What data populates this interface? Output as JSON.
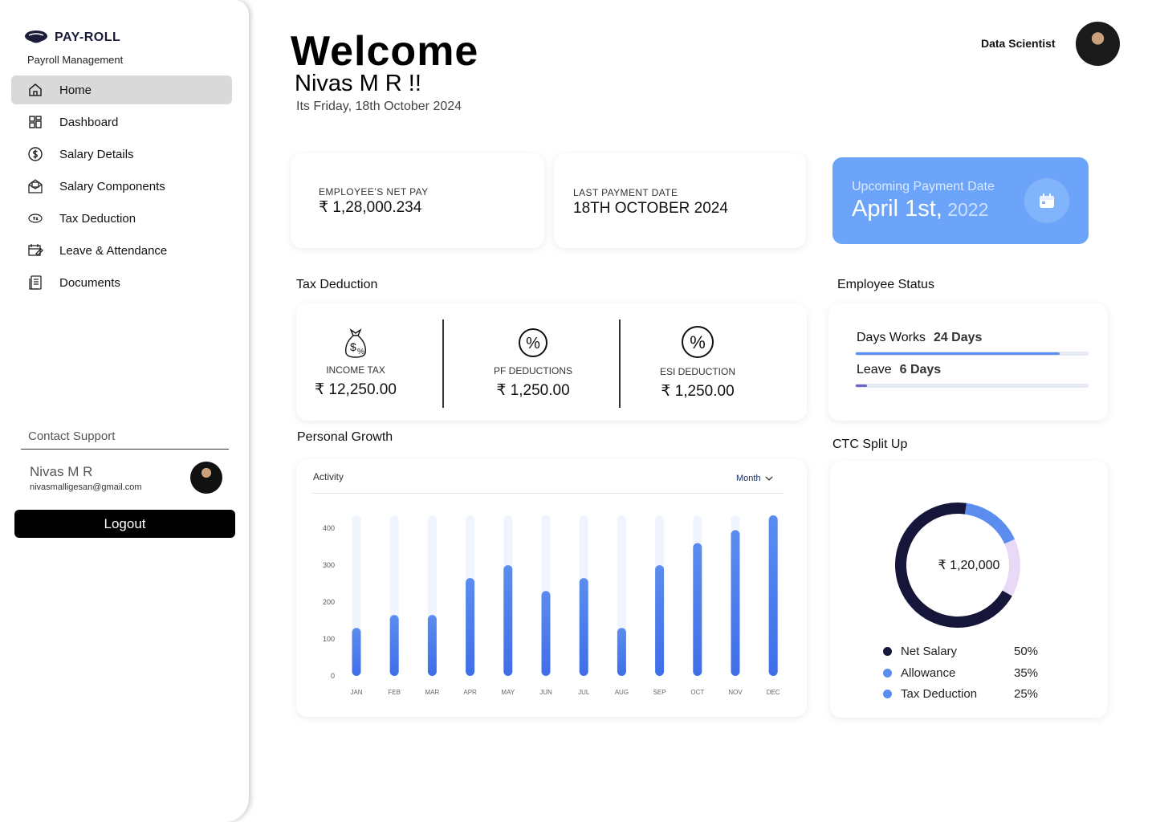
{
  "sidebar": {
    "brand": "PAY-ROLL",
    "subtitle": "Payroll Management",
    "items": [
      {
        "label": "Home",
        "icon": "home-icon"
      },
      {
        "label": "Dashboard",
        "icon": "dashboard-icon"
      },
      {
        "label": "Salary Details",
        "icon": "dollar-circle-icon"
      },
      {
        "label": "Salary Components",
        "icon": "envelope-icon"
      },
      {
        "label": "Tax Deduction",
        "icon": "tax-icon"
      },
      {
        "label": "Leave & Attendance",
        "icon": "calendar-edit-icon"
      },
      {
        "label": "Documents",
        "icon": "document-icon"
      }
    ],
    "support_title": "Contact Support",
    "user_name": "Nivas M R",
    "user_email": "nivasmalligesan@gmail.com",
    "logout": "Logout"
  },
  "header": {
    "welcome": "Welcome",
    "name": "Nivas M R !!",
    "date": "Its Friday, 18th October 2024",
    "role": "Data Scientist"
  },
  "stats": {
    "net_pay_label": "EMPLOYEE’S NET PAY",
    "net_pay_value": "₹ 1,28,000.234",
    "last_payment_label": "LAST PAYMENT DATE",
    "last_payment_value": "18TH OCTOBER 2024",
    "upcoming_label": "Upcoming Payment Date",
    "upcoming_date": "April 1st,",
    "upcoming_year": " 2022"
  },
  "tax": {
    "title": "Tax  Deduction",
    "items": [
      {
        "label": "INCOME TAX",
        "value": "₹ 12,250.00"
      },
      {
        "label": "PF DEDUCTIONS",
        "value": "₹ 1,250.00"
      },
      {
        "label": "ESI DEDUCTION",
        "value": "₹ 1,250.00"
      }
    ]
  },
  "employee_status": {
    "title": "Employee Status",
    "days_label": "Days Works",
    "days_value": "24 Days",
    "days_fraction": 0.88,
    "leave_label": "Leave",
    "leave_value": "6 Days",
    "leave_fraction": 0.05,
    "colors": {
      "days": "#5b8def",
      "leave": "#6d62c9"
    }
  },
  "growth": {
    "title": "Personal Growth",
    "chart_title": "Activity",
    "period": "Month"
  },
  "chart_data": {
    "type": "bar",
    "title": "Activity",
    "categories": [
      "JAN",
      "FEB",
      "MAR",
      "APR",
      "MAY",
      "JUN",
      "JUL",
      "AUG",
      "SEP",
      "OCT",
      "NOV",
      "DEC"
    ],
    "values": [
      130,
      165,
      165,
      265,
      300,
      230,
      265,
      130,
      300,
      360,
      395,
      435
    ],
    "yticks": [
      0,
      100,
      200,
      300,
      400
    ],
    "ylim": [
      0,
      435
    ],
    "grid": false,
    "colors": {
      "bar_top": "#5b8def",
      "bar_bottom": "#3f6ee8",
      "track": "#f0f4fc"
    }
  },
  "ctc": {
    "title": "CTC Split Up",
    "center": "₹ 1,20,000",
    "legend": [
      {
        "name": "Net Salary",
        "pct": "50%",
        "color": "#16163a"
      },
      {
        "name": "Allowance",
        "pct": "35%",
        "color": "#5b8def"
      },
      {
        "name": "Tax Deduction",
        "pct": "25%",
        "color": "#5b8def"
      }
    ],
    "slices": [
      {
        "name": "Net Salary",
        "value": 0.69,
        "color": "#16163a"
      },
      {
        "name": "Allowance",
        "value": 0.16,
        "color": "#5b8def"
      },
      {
        "name": "Tax Deduction",
        "value": 0.15,
        "color": "#e9d9f6"
      }
    ]
  }
}
